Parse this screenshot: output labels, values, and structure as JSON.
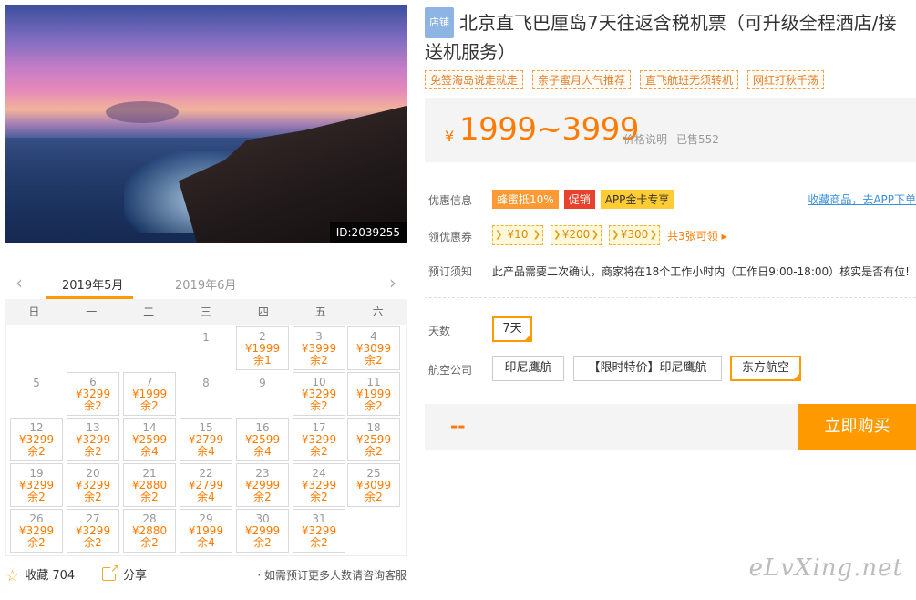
{
  "photo": {
    "id_label": "ID:2039255"
  },
  "calendar": {
    "prev_icon": "chevron-left-icon",
    "next_icon": "chevron-right-icon",
    "active_month": "2019年5月",
    "next_month": "2019年6月",
    "weekdays": [
      "日",
      "一",
      "二",
      "三",
      "四",
      "五",
      "六"
    ],
    "cells": [
      {
        "day": "1",
        "price": "",
        "remain": ""
      },
      {
        "day": "2",
        "price": "¥1999",
        "remain": "余1"
      },
      {
        "day": "3",
        "price": "¥3999",
        "remain": "余2"
      },
      {
        "day": "4",
        "price": "¥3099",
        "remain": "余2"
      },
      {
        "day": "5",
        "price": "",
        "remain": ""
      },
      {
        "day": "6",
        "price": "¥3299",
        "remain": "余2"
      },
      {
        "day": "7",
        "price": "¥1999",
        "remain": "余2"
      },
      {
        "day": "8",
        "price": "",
        "remain": ""
      },
      {
        "day": "9",
        "price": "",
        "remain": ""
      },
      {
        "day": "10",
        "price": "¥3299",
        "remain": "余2"
      },
      {
        "day": "11",
        "price": "¥1999",
        "remain": "余2"
      },
      {
        "day": "12",
        "price": "¥3299",
        "remain": "余2"
      },
      {
        "day": "13",
        "price": "¥3299",
        "remain": "余2"
      },
      {
        "day": "14",
        "price": "¥2599",
        "remain": "余4"
      },
      {
        "day": "15",
        "price": "¥2799",
        "remain": "余4"
      },
      {
        "day": "16",
        "price": "¥2599",
        "remain": "余4"
      },
      {
        "day": "17",
        "price": "¥3299",
        "remain": "余2"
      },
      {
        "day": "18",
        "price": "¥2599",
        "remain": "余2"
      },
      {
        "day": "19",
        "price": "¥3299",
        "remain": "余2"
      },
      {
        "day": "20",
        "price": "¥3299",
        "remain": "余2"
      },
      {
        "day": "21",
        "price": "¥2880",
        "remain": "余2"
      },
      {
        "day": "22",
        "price": "¥2799",
        "remain": "余4"
      },
      {
        "day": "23",
        "price": "¥2999",
        "remain": "余2"
      },
      {
        "day": "24",
        "price": "¥3299",
        "remain": "余2"
      },
      {
        "day": "25",
        "price": "¥3099",
        "remain": "余2"
      },
      {
        "day": "26",
        "price": "¥3299",
        "remain": "余2"
      },
      {
        "day": "27",
        "price": "¥3299",
        "remain": "余2"
      },
      {
        "day": "28",
        "price": "¥2880",
        "remain": "余2"
      },
      {
        "day": "29",
        "price": "¥1999",
        "remain": "余4"
      },
      {
        "day": "30",
        "price": "¥2999",
        "remain": "余2"
      },
      {
        "day": "31",
        "price": "¥3299",
        "remain": "余2"
      }
    ]
  },
  "footer_left": {
    "favorite_icon": "star-icon",
    "favorite_label": "收藏 704",
    "share_icon": "share-icon",
    "share_label": "分享",
    "consult_text": "· 如需预订更多人数请咨询客服"
  },
  "product": {
    "store_badge": "店铺",
    "title": "北京直飞巴厘岛7天往返含税机票（可升级全程酒店/接送机服务）",
    "tags": [
      "免签海岛说走就走",
      "亲子蜜月人气推荐",
      "直飞航班无须转机",
      "网红打秋千荡"
    ]
  },
  "price": {
    "currency": "¥",
    "range": "1999~3999",
    "explain": "价格说明",
    "sold": "已售552"
  },
  "promo": {
    "label": "优惠信息",
    "badges": [
      "蜂蜜抵10%",
      "促销",
      "APP金卡专享"
    ],
    "fav_app": "收藏商品，去APP下单"
  },
  "coupons": {
    "label": "领优惠券",
    "items": [
      "¥10",
      "¥200",
      "¥300"
    ],
    "more": "共3张可领 ▸"
  },
  "notice": {
    "label": "预订须知",
    "text": "此产品需要二次确认，商家将在18个工作小时内（工作日9:00-18:00）核实是否有位!"
  },
  "options": {
    "days_label": "天数",
    "days": [
      "7天"
    ],
    "airline_label": "航空公司",
    "airlines": [
      "印尼鹰航",
      "【限时特价】印尼鹰航",
      "东方航空"
    ]
  },
  "buy": {
    "price_placeholder": "--",
    "button": "立即购买"
  },
  "watermark": "eLvXing.net",
  "colors": {
    "accent": "#ff9900",
    "price": "#ff7a00",
    "link": "#3b8fdc"
  }
}
